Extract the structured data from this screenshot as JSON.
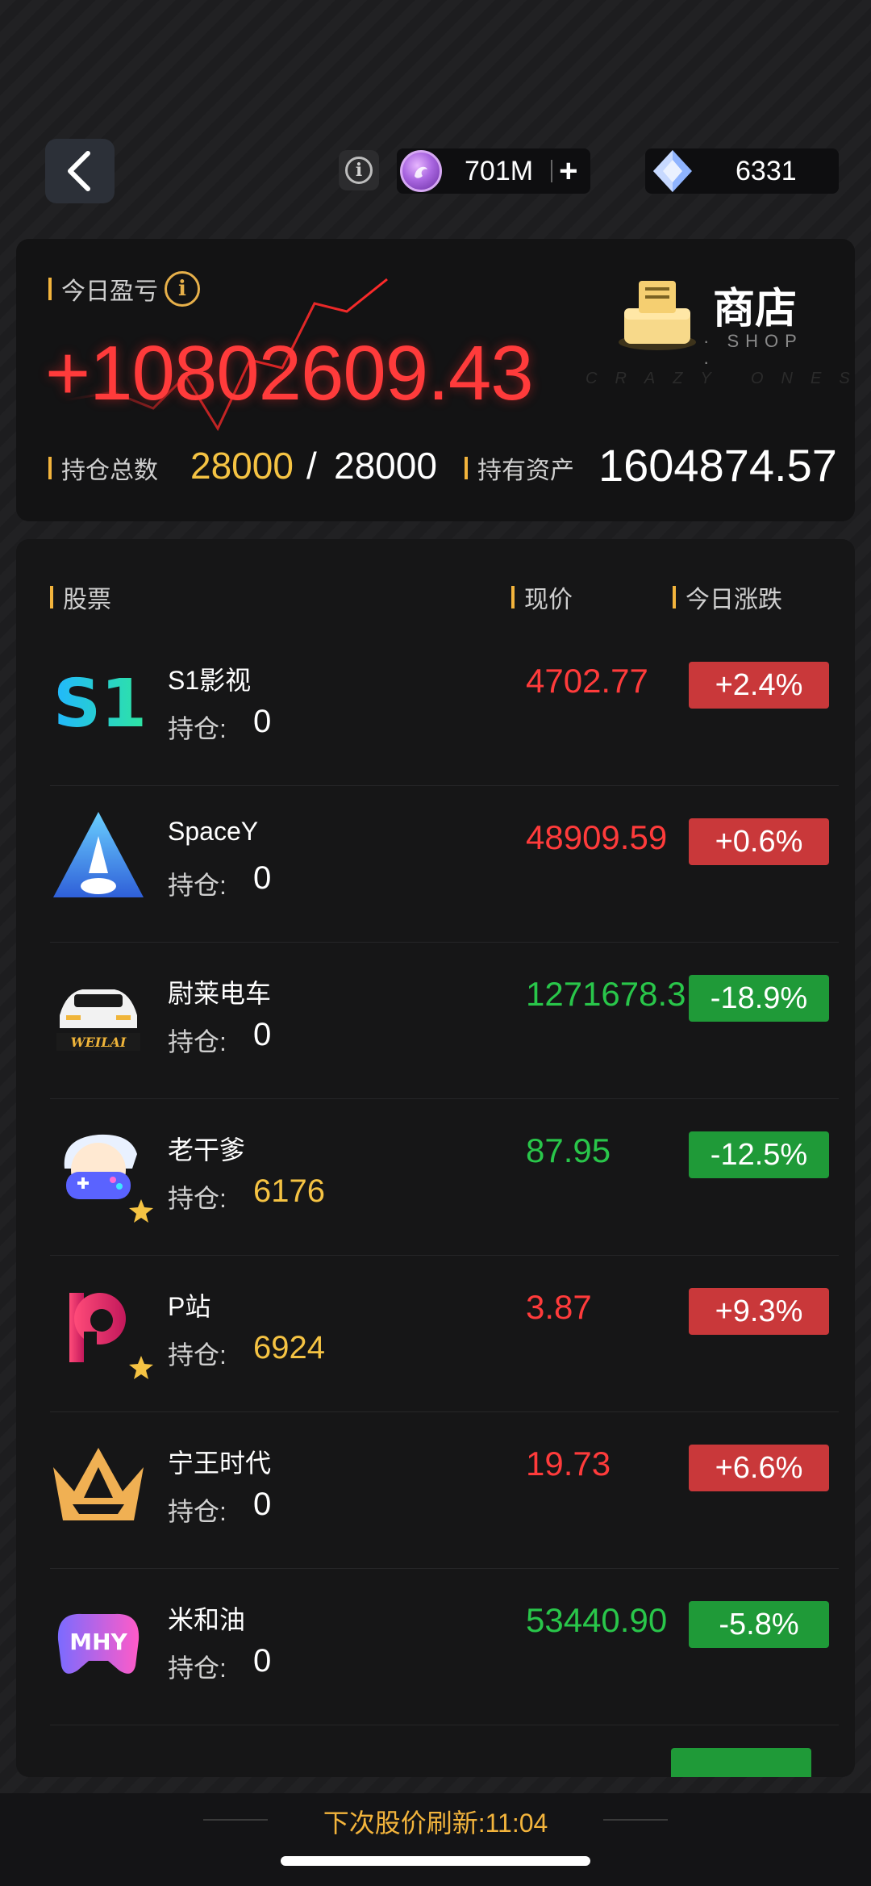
{
  "topbar": {
    "coins": "701M",
    "coin_add": "+",
    "gems": "6331"
  },
  "summary": {
    "pnl_label": "今日盈亏",
    "pnl_value": "+10802609.43",
    "shop_label": "商店",
    "shop_sub": "· SHOP ·",
    "watermark": "CRAZY ONES",
    "holdings_label": "持仓总数",
    "holdings_current": "28000",
    "holdings_sep": "/",
    "holdings_total": "28000",
    "assets_label": "持有资产",
    "assets_value": "1604874.57"
  },
  "table": {
    "header_stock": "股票",
    "header_price": "现价",
    "header_change": "今日涨跌",
    "hold_label": "持仓:",
    "rows": [
      {
        "name": "S1影视",
        "holding": "0",
        "price": "4702.77",
        "change": "+2.4%",
        "direction": "up",
        "logo": "s1-film-logo-icon",
        "starred": false
      },
      {
        "name": "SpaceY",
        "holding": "0",
        "price": "48909.59",
        "change": "+0.6%",
        "direction": "up",
        "logo": "rocket-logo-icon",
        "starred": false
      },
      {
        "name": "尉莱电车",
        "holding": "0",
        "price": "1271678.3",
        "change": "-18.9%",
        "direction": "down",
        "logo": "weilai-car-logo-icon",
        "logo_text": "WEILAI",
        "starred": false
      },
      {
        "name": "老干爹",
        "holding": "6176",
        "price": "87.95",
        "change": "-12.5%",
        "direction": "down",
        "logo": "gamer-logo-icon",
        "starred": true
      },
      {
        "name": "P站",
        "holding": "6924",
        "price": "3.87",
        "change": "+9.3%",
        "direction": "up",
        "logo": "p-site-logo-icon",
        "starred": true
      },
      {
        "name": "宁王时代",
        "holding": "0",
        "price": "19.73",
        "change": "+6.6%",
        "direction": "up",
        "logo": "crown-logo-icon",
        "starred": false
      },
      {
        "name": "米和油",
        "holding": "0",
        "price": "53440.90",
        "change": "-5.8%",
        "direction": "down",
        "logo": "mhy-controller-logo-icon",
        "logo_text": "MHY",
        "starred": false
      }
    ]
  },
  "footer": {
    "refresh_label": "下次股价刷新:",
    "refresh_time": "11:04"
  },
  "colors": {
    "up": "#ff3b3b",
    "down": "#29c64a",
    "accent": "#f3b43c"
  }
}
